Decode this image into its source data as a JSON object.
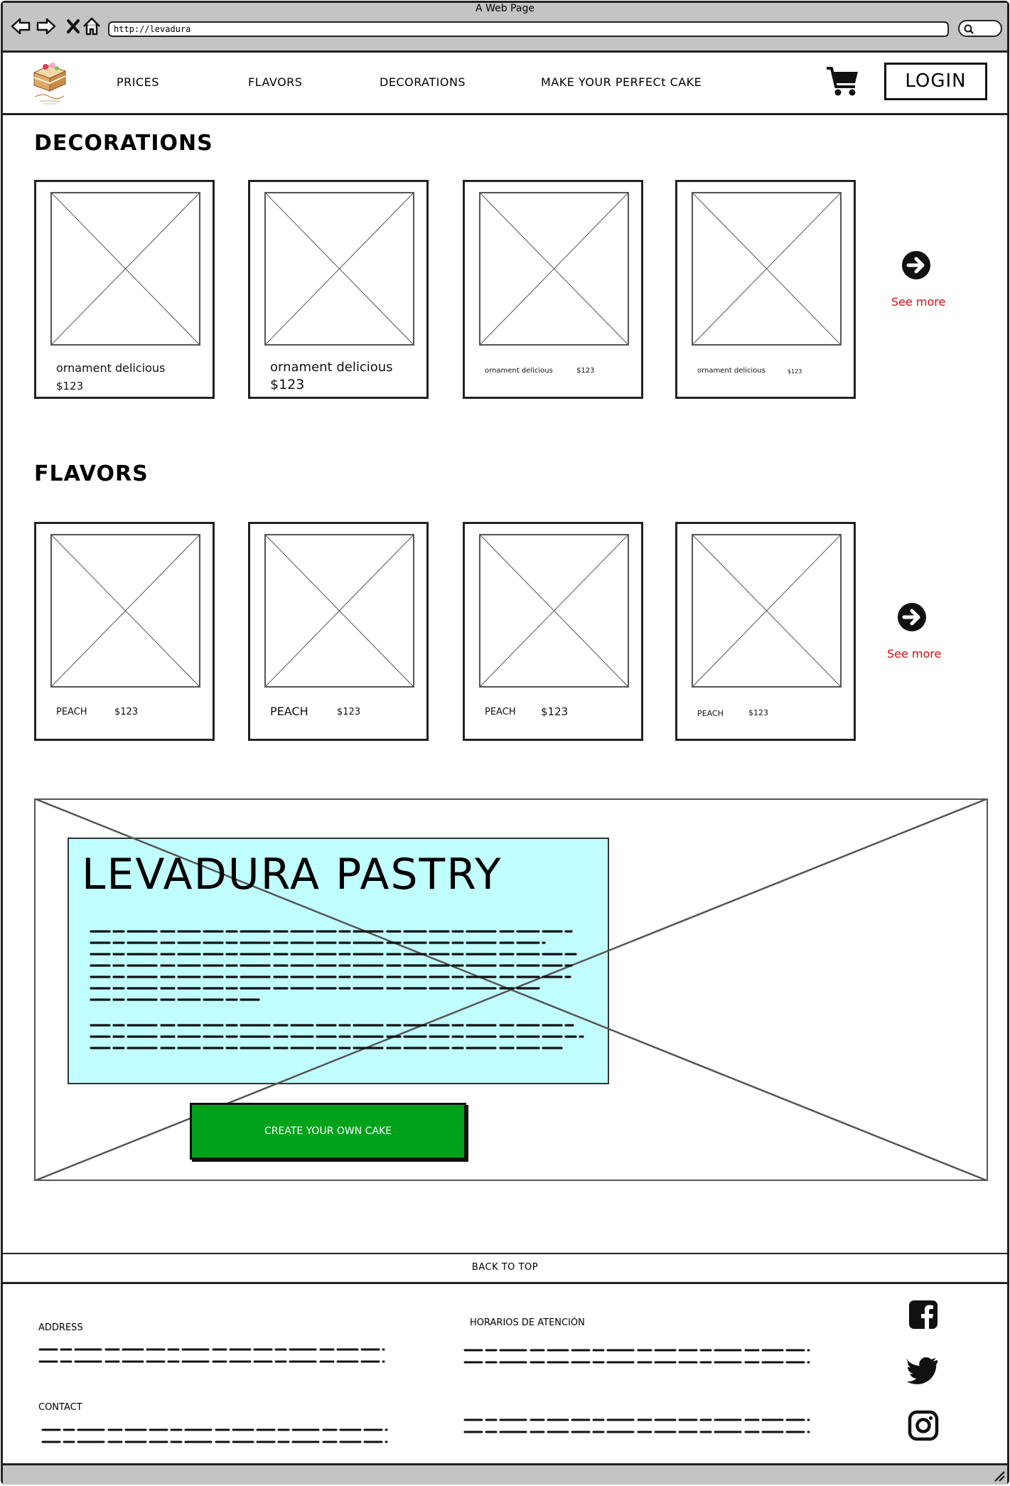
{
  "browser": {
    "window_title": "A Web Page",
    "url": "http://levadura"
  },
  "header": {
    "nav": [
      "PRICES",
      "FLAVORS",
      "DECORATIONS",
      "MAKE YOUR PERFECt CAKE"
    ],
    "login_label": "LOGIN",
    "icons": [
      "logo-cake-icon",
      "cart-icon"
    ]
  },
  "decorations": {
    "title": "DECORATIONS",
    "items": [
      {
        "name": "ornament delicious",
        "price": "$123"
      },
      {
        "name": "ornament delicious",
        "price": "$123"
      },
      {
        "name": "ornament delicious",
        "price": "$123"
      },
      {
        "name": "ornament delicious",
        "price": "$123"
      }
    ],
    "see_more": "See more"
  },
  "flavors": {
    "title": "FLAVORS",
    "items": [
      {
        "name": "PEACH",
        "price": "$123"
      },
      {
        "name": "PEACH",
        "price": "$123"
      },
      {
        "name": "PEACH",
        "price": "$123"
      },
      {
        "name": "PEACH",
        "price": "$123"
      }
    ],
    "see_more": "See more"
  },
  "hero": {
    "title": "LEVADURA PASTRY",
    "cta_label": "CREATE YOUR OWN CAKE"
  },
  "footer": {
    "back_to_top": "BACK TO TOP",
    "address_label": "ADDRESS",
    "contact_label": "CONTACT",
    "hours_label": "HORARIOS DE ATENCIÓN",
    "social_icons": [
      "facebook-icon",
      "twitter-icon",
      "instagram-icon"
    ]
  },
  "colors": {
    "hero_box_bg": "#c0feff",
    "cta_bg": "#00a21a",
    "see_more": "#d01010",
    "chrome_gray": "#c4c4c4"
  }
}
